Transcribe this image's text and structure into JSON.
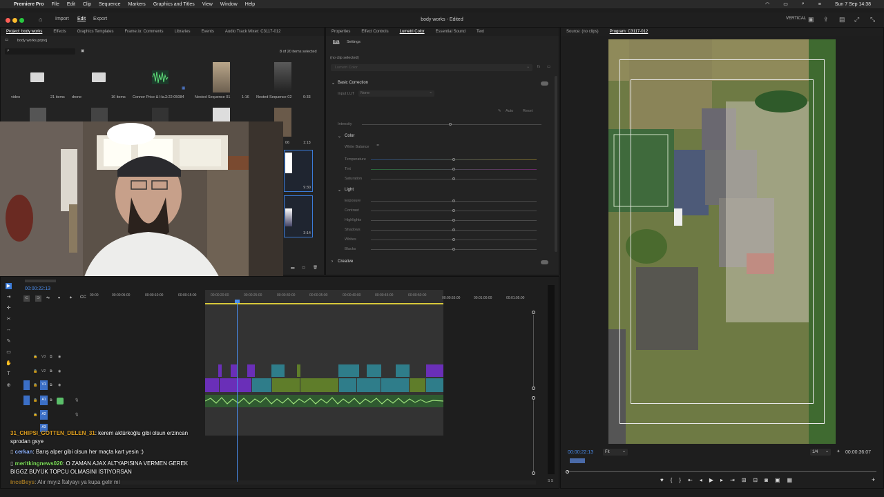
{
  "menubar": {
    "app_name": "Premiere Pro",
    "items": [
      "File",
      "Edit",
      "Clip",
      "Sequence",
      "Markers",
      "Graphics and Titles",
      "View",
      "Window",
      "Help"
    ],
    "clock": "Sun 7 Sep  14:38"
  },
  "titlebar": {
    "workspaces": [
      "Import",
      "Edit",
      "Export"
    ],
    "active_workspace": "Edit",
    "document_title": "body works - Edited",
    "layout_label": "VERTICAL"
  },
  "project_panel": {
    "tabs": [
      "Project: body works",
      "Effects",
      "Graphics Templates",
      "Frame.io: Comments",
      "Libraries",
      "Events",
      "Audio Track Mixer: C3117-012"
    ],
    "path": "body works.prproj",
    "items_selected": "8 of 20 items selected",
    "items": [
      {
        "name": "video",
        "meta": "21 items"
      },
      {
        "name": "drone",
        "meta": "16 items"
      },
      {
        "name": "Connor Price & Ha...",
        "meta": "2:22:05084"
      },
      {
        "name": "Nested Sequence 01",
        "meta": "1:16"
      },
      {
        "name": "Nested Sequence 02",
        "meta": "0:33"
      }
    ],
    "durations": [
      "1:13",
      "9:30",
      "3:14"
    ],
    "partial_label": "06"
  },
  "lumetri_panel": {
    "tabs": [
      "Properties",
      "Effect Controls",
      "Lumetri Color",
      "Essential Sound",
      "Text"
    ],
    "subtabs": [
      "Edit",
      "Settings"
    ],
    "no_clip": "(no clip selected)",
    "preset": "Lumetri Color",
    "basic_correction": "Basic Correction",
    "input_lut_label": "Input LUT",
    "input_lut_value": "None",
    "auto": "Auto",
    "reset": "Reset",
    "intensity": "Intensity",
    "color_section": "Color",
    "white_balance": "White Balance",
    "color_sliders": [
      "Temperature",
      "Tint",
      "Saturation"
    ],
    "light_section": "Light",
    "light_sliders": [
      "Exposure",
      "Contrast",
      "Highlights",
      "Shadows",
      "Whites",
      "Blacks"
    ],
    "creative": "Creative"
  },
  "source_monitor": {
    "tab": "Source: (no clips)"
  },
  "program_monitor": {
    "tab": "Program: C3117-012",
    "timecode": "00:00:22:13",
    "fit": "Fit",
    "resolution": "1/4",
    "duration": "00:00:36:07"
  },
  "timeline": {
    "timecode": "00:00:22:13",
    "ruler": [
      "00:00",
      "00:00:05:00",
      "00:00:10:00",
      "00:00:15:00",
      "00:00:20:00",
      "00:00:25:00",
      "00:00:30:00",
      "00:00:35:00",
      "00:00:40:00",
      "00:00:45:00",
      "00:00:50:00",
      "00:00:55:00",
      "00:01:00:00",
      "00:01:05:00"
    ],
    "tracks": [
      {
        "name": "V3"
      },
      {
        "name": "V2"
      },
      {
        "name": "V1"
      },
      {
        "name": "A1"
      },
      {
        "name": "A2"
      },
      {
        "name": "A3"
      }
    ],
    "meter_label": "S S"
  },
  "chat": [
    {
      "user": "31_CHIPSI_GOTTEN_DELEN_31",
      "user_color": "#e0a020",
      "message": "kerem aktürkoğlu gibi olsun erzincan sprodan gsye"
    },
    {
      "user": "cerkan",
      "user_color": "#8fb4ff",
      "message": "Barış alper gibi olsun her maçta kart yesin :)"
    },
    {
      "user": "meritkingnews020",
      "user_color": "#7ee05a",
      "message": "O ZAMAN AJAX ALTYAPISINA VERMEN GEREK BIGGZ BÜYÜK TOPCU OLMASINI İSTİYORSAN"
    },
    {
      "user": "inceBeys",
      "user_color": "#e0a020",
      "message": "Alır mıyız İtalyayı ya kupa gelir mi"
    }
  ],
  "colors": {
    "accent_blue": "#3b7bd8",
    "clip_purple": "#6a2fb8",
    "clip_teal": "#2f7d8a",
    "clip_olive": "#5f7d2a",
    "audio_green": "#6cb04c",
    "playhead": "#4a8ef0"
  }
}
